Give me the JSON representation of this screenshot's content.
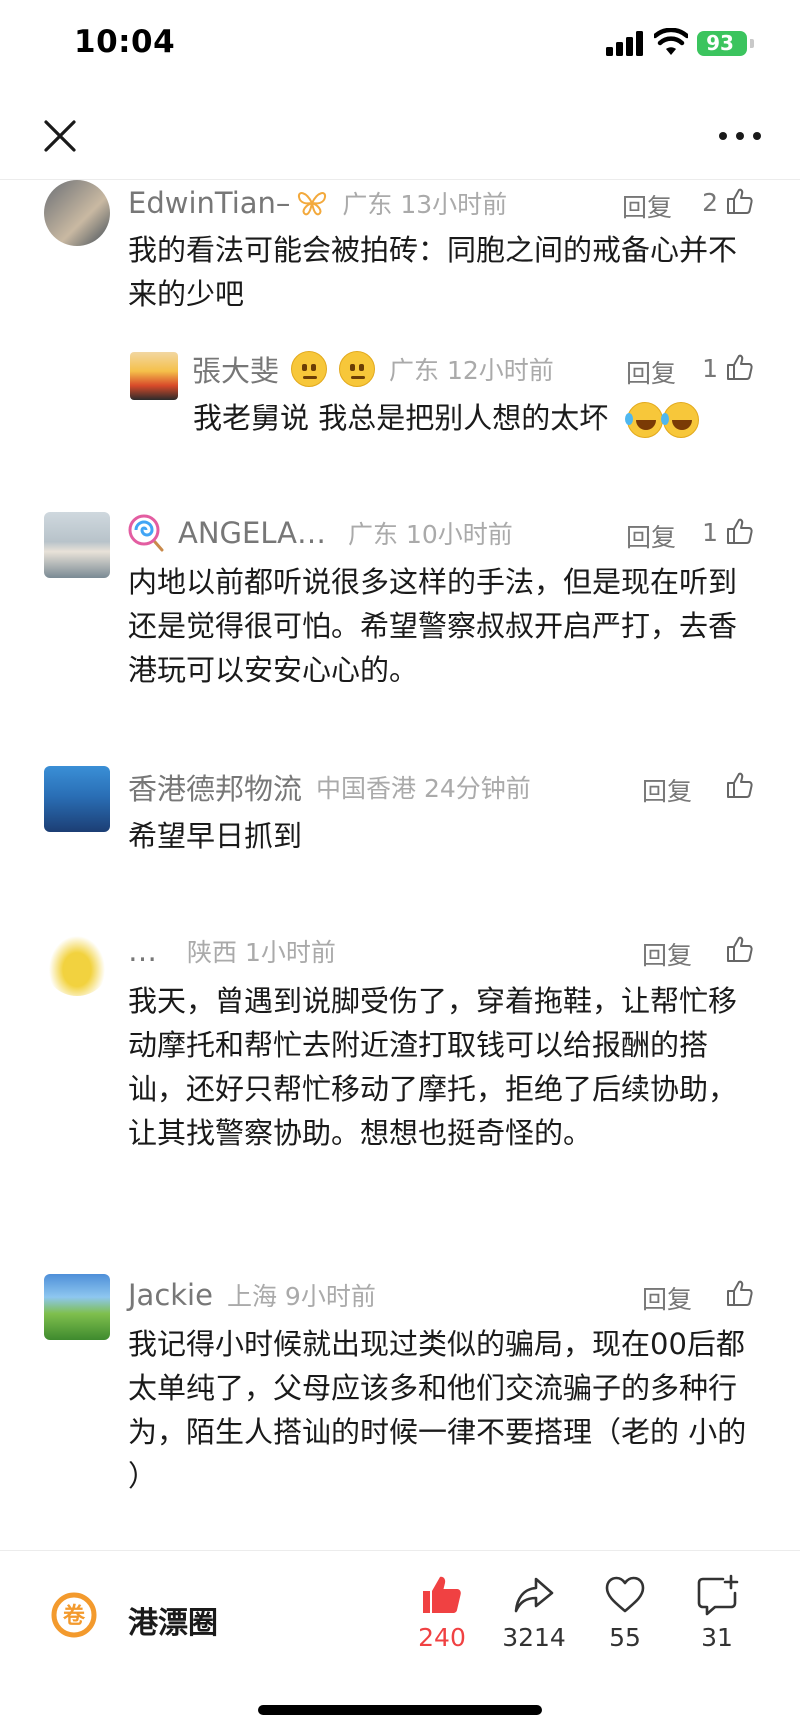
{
  "status_bar": {
    "time": "10:04",
    "battery": "93"
  },
  "comments": [
    {
      "username": "EdwinTian–",
      "badge_icon": "butterfly-icon",
      "location": "广东 13小时前",
      "reply_label": "回复",
      "likes": "2",
      "text": "我的看法可能会被拍砖：同胞之间的戒备心并不来的少吧",
      "reply": {
        "username": "張大斐",
        "location": "广东 12小时前",
        "reply_label": "回复",
        "likes": "1",
        "text": "我老舅说 我总是把别人想的太坏"
      }
    },
    {
      "username": "ANGELA…",
      "badge_icon": "lollipop-icon",
      "location": "广东 10小时前",
      "reply_label": "回复",
      "likes": "1",
      "text": "内地以前都听说很多这样的手法，但是现在听到还是觉得很可怕。希望警察叔叔开启严打，去香港玩可以安安心心的。"
    },
    {
      "username": "香港德邦物流",
      "location": "中国香港 24分钟前",
      "reply_label": "回复",
      "likes": "",
      "text": "希望早日抓到"
    },
    {
      "username": "…",
      "location": "陕西 1小时前",
      "reply_label": "回复",
      "likes": "",
      "text": "我天，曾遇到说脚受伤了，穿着拖鞋，让帮忙移动摩托和帮忙去附近渣打取钱可以给报酬的搭讪，还好只帮忙移动了摩托，拒绝了后续协助，让其找警察协助。想想也挺奇怪的。"
    },
    {
      "username": "Jackie",
      "location": "上海 9小时前",
      "reply_label": "回复",
      "likes": "",
      "text": "我记得小时候就出现过类似的骗局，现在00后都太单纯了，父母应该多和他们交流骗子的多种行为，陌生人搭讪的时候一律不要搭理（老的 小的 ）"
    }
  ],
  "bottom_bar": {
    "channel_name": "港漂圈",
    "channel_logo_text": "卷",
    "like_count": "240",
    "share_count": "3214",
    "favorite_count": "55",
    "comment_count": "31"
  },
  "colors": {
    "accent": "#f04142",
    "battery": "#3bc45e",
    "meta_gray": "#777777"
  }
}
